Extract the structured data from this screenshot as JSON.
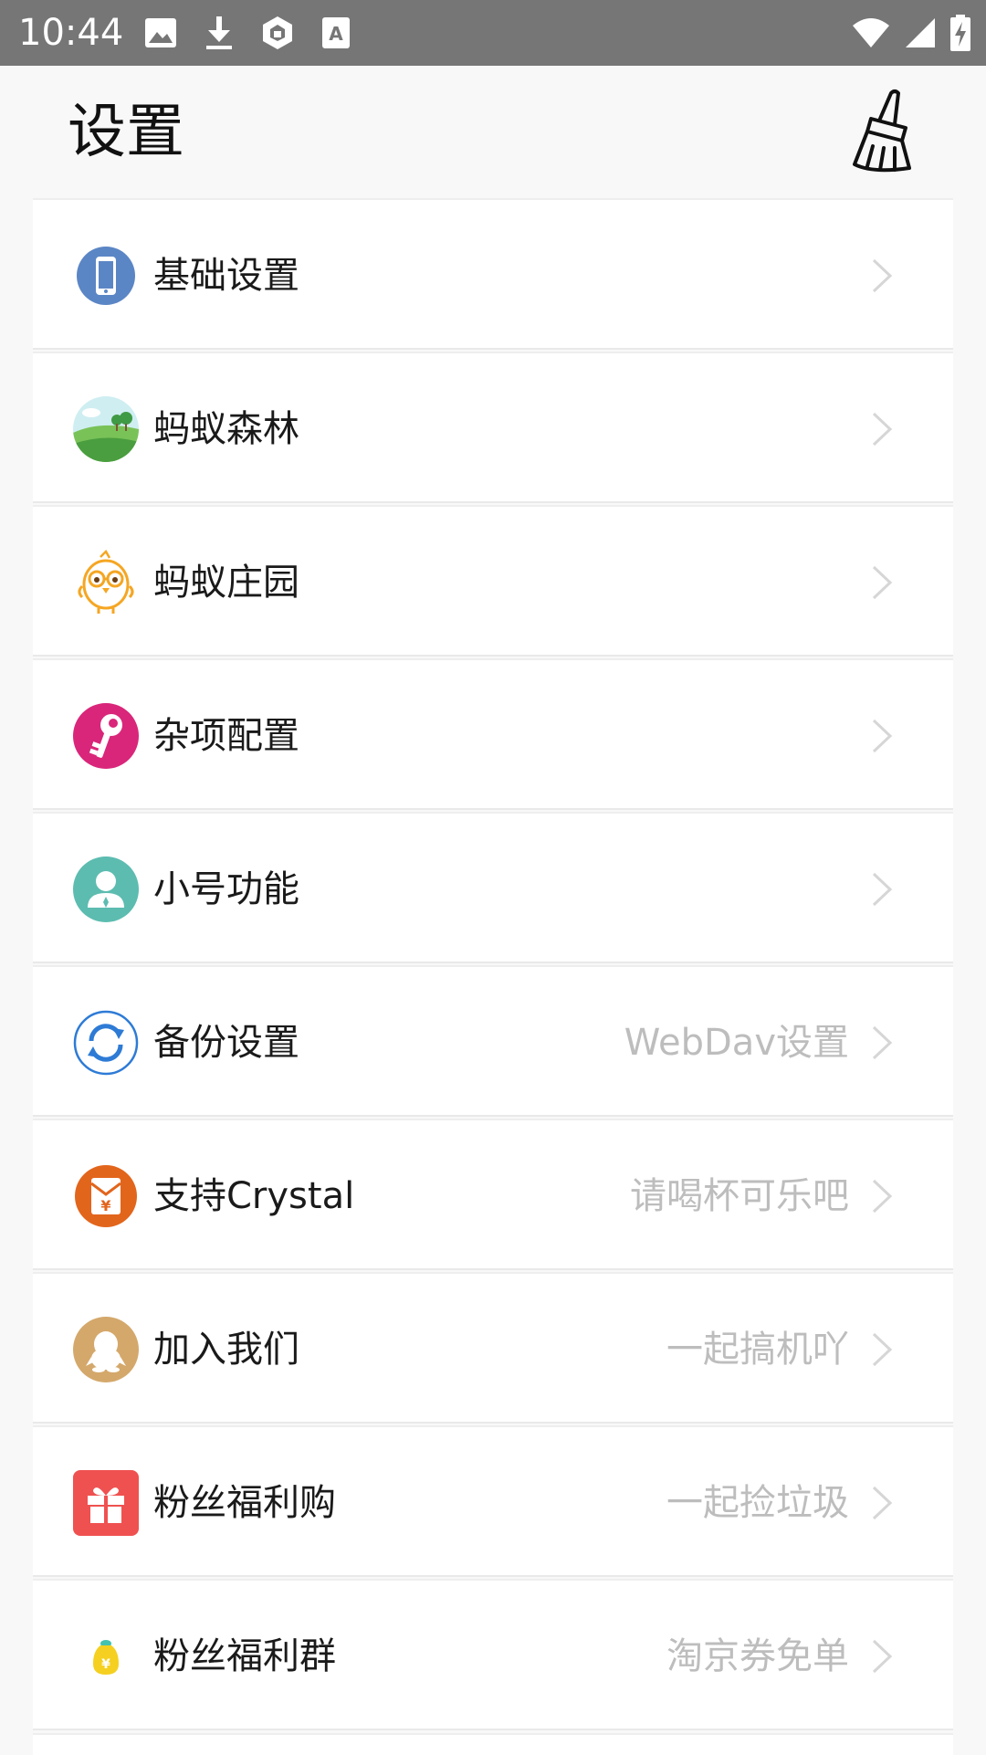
{
  "status_bar": {
    "time": "10:44",
    "icons_left": [
      "image-icon",
      "download-icon",
      "shield-icon",
      "text-badge-icon"
    ],
    "icons_right": [
      "wifi-icon",
      "cellular-signal-icon",
      "battery-charging-icon"
    ]
  },
  "header": {
    "title": "设置",
    "clean_icon": "broom-icon"
  },
  "settings": {
    "items": [
      {
        "label": "基础设置",
        "hint": "",
        "icon": "phone-icon"
      },
      {
        "label": "蚂蚁森林",
        "hint": "",
        "icon": "forest-landscape-icon"
      },
      {
        "label": "蚂蚁庄园",
        "hint": "",
        "icon": "chick-icon"
      },
      {
        "label": "杂项配置",
        "hint": "",
        "icon": "key-icon"
      },
      {
        "label": "小号功能",
        "hint": "",
        "icon": "user-icon"
      },
      {
        "label": "备份设置",
        "hint": "WebDav设置",
        "icon": "sync-icon"
      },
      {
        "label": "支持Crystal",
        "hint": "请喝杯可乐吧",
        "icon": "red-envelope-icon"
      },
      {
        "label": "加入我们",
        "hint": "一起搞机吖",
        "icon": "qq-penguin-icon"
      },
      {
        "label": "粉丝福利购",
        "hint": "一起捡垃圾",
        "icon": "gift-icon"
      },
      {
        "label": "粉丝福利群",
        "hint": "淘京券免单",
        "icon": "money-bag-icon"
      }
    ]
  },
  "colors": {
    "status_bar": "#767676",
    "background": "#f8f8f8",
    "hint_text": "#bdbdbd",
    "chevron": "#d6d6d6"
  }
}
